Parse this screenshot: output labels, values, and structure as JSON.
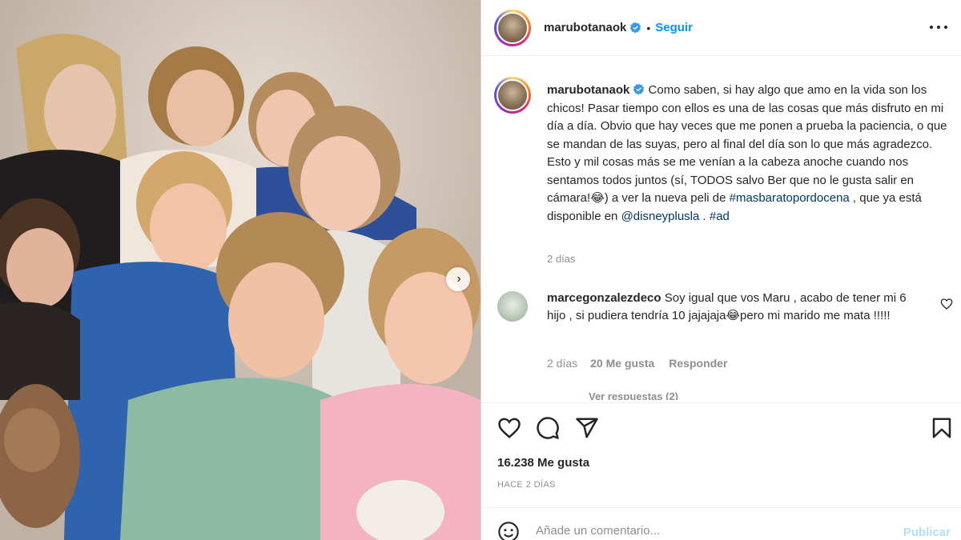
{
  "post": {
    "username": "marubotanaok",
    "follow_label": "Seguir",
    "dot": "•"
  },
  "caption": {
    "username": "marubotanaok",
    "text_1": " Como saben, si hay algo que amo en la vida son los chicos! Pasar tiempo con ellos es una de las cosas que más disfruto en mi día a día. Obvio que hay veces que me ponen a prueba la paciencia, o que se mandan de las suyas, pero al final del día son lo que más agradezco. Esto y mil cosas más se me venían a la cabeza anoche cuando nos sentamos todos juntos (sí, TODOS salvo Ber que no le gusta salir en cámara!",
    "emoji_1": "😂",
    "text_2": ") a ver la nueva peli de ",
    "hashtag": "#masbaratopordocena",
    "text_3": " , que ya está disponible en ",
    "mention": "@disneyplusla",
    "text_4": " . ",
    "hashtag_2": "#ad",
    "time": "2 días"
  },
  "comment": {
    "username": "marcegonzalezdeco",
    "text_1": " Soy igual que vos Maru , acabo de tener mi 6 hijo , si pudiera tendría 10 jajajaja",
    "emoji": "😂",
    "text_2": "pero mi marido me mata !!!!!",
    "time": "2 días",
    "likes": "20 Me gusta",
    "reply": "Responder",
    "view_replies": "Ver respuestas (2)"
  },
  "actions": {
    "likes": "16.238 Me gusta",
    "ago": "HACE 2 DÍAS"
  },
  "add_comment": {
    "placeholder": "Añade un comentario...",
    "publish": "Publicar"
  },
  "colors": {
    "accent": "#0095f6",
    "link": "#00376b",
    "muted": "#8e8e8e",
    "publish_disabled": "#b2dffc"
  }
}
